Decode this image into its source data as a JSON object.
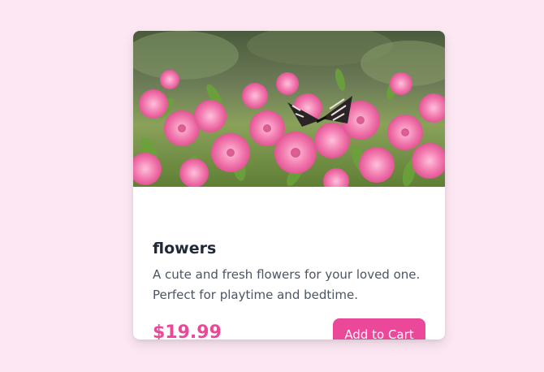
{
  "product": {
    "image_alt": "pink flowers with butterfly",
    "title": "flowers",
    "description": "A cute and fresh flowers for your loved one. Perfect for playtime and bedtime.",
    "price": "$19.99",
    "add_to_cart_label": "Add to Cart"
  },
  "colors": {
    "page_background": "#fce7f3",
    "accent": "#ec4899",
    "title_text": "#1f2937",
    "body_text": "#4b5563"
  }
}
